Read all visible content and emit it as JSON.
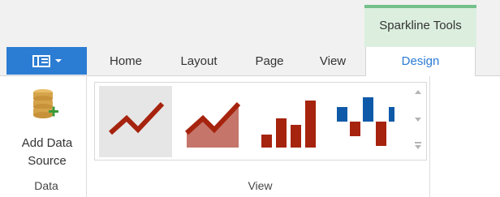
{
  "contextual_tab": {
    "label": "Sparkline Tools"
  },
  "tabs": [
    {
      "label": "Home"
    },
    {
      "label": "Layout"
    },
    {
      "label": "Page"
    },
    {
      "label": "View"
    },
    {
      "label": "Design"
    }
  ],
  "active_tab": "Design",
  "groups": {
    "data": {
      "label": "Data",
      "add_button_label": "Add Data\nSource"
    },
    "view": {
      "label": "View",
      "gallery": {
        "items": [
          {
            "name": "line",
            "selected": true
          },
          {
            "name": "area",
            "selected": false
          },
          {
            "name": "column",
            "selected": false
          },
          {
            "name": "win-loss",
            "selected": false
          }
        ]
      }
    }
  },
  "colors": {
    "accent_blue": "#2b7cd3",
    "contextual_green": "#74c08b",
    "sparkline_red": "#a6230e",
    "winloss_blue": "#0f5aa8",
    "database_gold": "#d5a44a",
    "add_green": "#3a9a3a"
  }
}
